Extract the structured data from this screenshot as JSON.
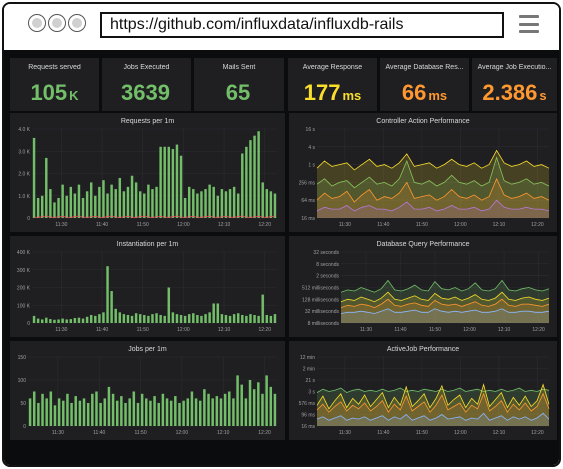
{
  "browser": {
    "url": "https://github.com/influxdata/influxdb-rails"
  },
  "stats": [
    {
      "title": "Requests served",
      "value": "105",
      "unit": "K",
      "color": "#73bf69"
    },
    {
      "title": "Jobs Executed",
      "value": "3639",
      "unit": "",
      "color": "#73bf69"
    },
    {
      "title": "Mails Sent",
      "value": "65",
      "unit": "",
      "color": "#73bf69"
    },
    {
      "title": "Average Response",
      "value": "177",
      "unit": "ms",
      "color": "#fade2a"
    },
    {
      "title": "Average Database Res...",
      "value": "66",
      "unit": "ms",
      "color": "#ff9830"
    },
    {
      "title": "Average Job Executio...",
      "value": "2.386",
      "unit": "s",
      "color": "#ff9830"
    }
  ],
  "panels": {
    "requests": {
      "title": "Requests per 1m"
    },
    "controller": {
      "title": "Controller Action Performance"
    },
    "instantiation": {
      "title": "Instantiation per 1m"
    },
    "database": {
      "title": "Database Query Performance"
    },
    "jobs": {
      "title": "Jobs per 1m"
    },
    "activejob": {
      "title": "ActiveJob Performance"
    }
  },
  "chart_data": [
    {
      "type": "bar",
      "name": "requests-per-1m",
      "title": "Requests per 1m",
      "ylim": [
        0,
        4000
      ],
      "y_ticks": [
        "0",
        "1.0 K",
        "2.0 K",
        "3.0 K",
        "4.0 K"
      ],
      "y_tick_values": [
        0,
        1000,
        2000,
        3000,
        4000
      ],
      "x_ticks": [
        "11:30",
        "11:40",
        "11:50",
        "12:00",
        "12:10",
        "12:20"
      ],
      "color": "#73bf69",
      "values": [
        3600,
        900,
        1000,
        2700,
        1300,
        700,
        900,
        1500,
        1000,
        1400,
        1100,
        1500,
        900,
        1200,
        1600,
        1000,
        1400,
        1700,
        1100,
        1500,
        1300,
        1800,
        1200,
        1400,
        1900,
        1600,
        1200,
        1100,
        1500,
        1300,
        1400,
        3200,
        3200,
        3200,
        3100,
        3300,
        2800,
        900,
        1400,
        1300,
        1100,
        1200,
        1300,
        1500,
        1400,
        1000,
        1300,
        1200,
        1300,
        1400,
        1100,
        2900,
        3200,
        3500,
        3700,
        3900,
        1600,
        1300,
        1200,
        1100
      ],
      "series2_color": "#f2495c",
      "series2_values": [
        40,
        30,
        60,
        90,
        40,
        30,
        50,
        70,
        40,
        30,
        60,
        90,
        40,
        30,
        50,
        70,
        40,
        30,
        60,
        90,
        40,
        30,
        50,
        70,
        40,
        30,
        60,
        90,
        40,
        30,
        50,
        70,
        40,
        30,
        60,
        90,
        40,
        30,
        50,
        70,
        40,
        30,
        60,
        90,
        40,
        30,
        50,
        70,
        40,
        30,
        60,
        90,
        40,
        30,
        50,
        70,
        40,
        30,
        60,
        90
      ]
    },
    {
      "type": "line",
      "name": "controller-action-performance",
      "title": "Controller Action Performance",
      "y_ticks": [
        "16 ms",
        "64 ms",
        "256 ms",
        "1 s",
        "4 s",
        "16 s"
      ],
      "x_ticks": [
        "11:30",
        "11:40",
        "11:50",
        "12:00",
        "12:10",
        "12:20"
      ],
      "series": [
        {
          "color": "#73bf69",
          "values": [
            1.9,
            2.2,
            1.8,
            2.0,
            2.1,
            1.7,
            2.0,
            2.3,
            1.9,
            2.0,
            1.8,
            2.2,
            3.2,
            2.0,
            1.9,
            2.1,
            1.8,
            2.0,
            2.4,
            2.0,
            1.9,
            2.1,
            1.8,
            2.0,
            3.4,
            2.1,
            1.9,
            2.0,
            2.2,
            1.9,
            2.0,
            1.8
          ]
        },
        {
          "color": "#fade2a",
          "values": [
            2.8,
            3.2,
            2.9,
            3.0,
            3.1,
            2.7,
            3.0,
            3.3,
            2.9,
            3.0,
            2.8,
            3.1,
            3.6,
            2.9,
            3.0,
            3.1,
            2.8,
            3.0,
            3.3,
            3.0,
            2.9,
            3.1,
            2.8,
            3.0,
            3.8,
            3.1,
            2.9,
            3.0,
            3.2,
            2.9,
            3.0,
            2.8
          ]
        },
        {
          "color": "#ff9830",
          "values": [
            1.0,
            1.4,
            1.1,
            1.2,
            1.5,
            0.9,
            1.3,
            1.6,
            1.0,
            1.2,
            1.1,
            1.4,
            2.0,
            1.1,
            1.2,
            1.3,
            1.0,
            1.2,
            1.6,
            1.2,
            1.1,
            1.3,
            1.0,
            1.2,
            2.2,
            1.3,
            1.1,
            1.2,
            1.4,
            1.1,
            1.2,
            1.0
          ]
        },
        {
          "color": "#b877d9",
          "values": [
            0.4,
            0.6,
            0.5,
            0.5,
            0.7,
            0.4,
            0.6,
            0.7,
            0.5,
            0.5,
            0.4,
            0.6,
            0.9,
            0.5,
            0.5,
            0.6,
            0.4,
            0.5,
            0.7,
            0.5,
            0.5,
            0.6,
            0.4,
            0.5,
            1.0,
            0.6,
            0.5,
            0.5,
            0.6,
            0.5,
            0.5,
            0.4
          ]
        }
      ]
    },
    {
      "type": "bar",
      "name": "instantiation-per-1m",
      "title": "Instantiation per 1m",
      "ylim": [
        0,
        400000
      ],
      "y_ticks": [
        "0",
        "100 K",
        "200 K",
        "300 K",
        "400 K"
      ],
      "y_tick_values": [
        0,
        100000,
        200000,
        300000,
        400000
      ],
      "x_ticks": [
        "11:30",
        "11:40",
        "11:50",
        "12:00",
        "12:10",
        "12:20"
      ],
      "color": "#73bf69",
      "values": [
        40000,
        25000,
        20000,
        30000,
        22000,
        18000,
        20000,
        25000,
        20000,
        22000,
        28000,
        30000,
        25000,
        35000,
        45000,
        40000,
        50000,
        60000,
        320000,
        180000,
        80000,
        60000,
        50000,
        45000,
        40000,
        55000,
        50000,
        45000,
        40000,
        50000,
        55000,
        45000,
        40000,
        200000,
        60000,
        50000,
        45000,
        40000,
        50000,
        55000,
        45000,
        40000,
        50000,
        60000,
        110000,
        110000,
        50000,
        45000,
        40000,
        50000,
        55000,
        45000,
        40000,
        50000,
        45000,
        40000,
        160000,
        45000,
        40000,
        50000
      ]
    },
    {
      "type": "line",
      "name": "database-query-performance",
      "title": "Database Query Performance",
      "y_ticks": [
        "8 milliseconds",
        "32 milliseconds",
        "128 milliseconds",
        "512 milliseconds",
        "2 seconds",
        "8 seconds",
        "32 seconds"
      ],
      "x_ticks": [
        "11:30",
        "11:40",
        "11:50",
        "12:00",
        "12:10",
        "12:20"
      ],
      "series": [
        {
          "color": "#73bf69",
          "values": [
            2.6,
            2.8,
            2.7,
            3.0,
            2.8,
            2.6,
            2.9,
            3.6,
            2.8,
            2.7,
            2.9,
            3.2,
            2.8,
            2.7,
            3.5,
            2.9,
            2.8,
            3.0,
            2.7,
            2.9,
            3.4,
            2.8,
            2.7,
            2.9,
            3.6,
            2.8,
            2.7,
            2.9,
            3.0,
            2.8,
            2.7,
            2.9
          ]
        },
        {
          "color": "#fade2a",
          "values": [
            1.8,
            2.0,
            1.9,
            2.2,
            2.0,
            1.8,
            2.1,
            2.6,
            2.0,
            1.9,
            2.1,
            2.3,
            2.0,
            1.9,
            2.5,
            2.1,
            2.0,
            2.2,
            1.9,
            2.1,
            2.4,
            2.0,
            1.9,
            2.1,
            2.6,
            2.0,
            1.9,
            2.1,
            2.2,
            2.0,
            1.9,
            2.1
          ]
        },
        {
          "color": "#ff9830",
          "values": [
            1.3,
            1.5,
            1.4,
            1.6,
            1.5,
            1.3,
            1.6,
            2.0,
            1.5,
            1.4,
            1.6,
            1.7,
            1.5,
            1.4,
            1.9,
            1.6,
            1.5,
            1.6,
            1.4,
            1.6,
            1.8,
            1.5,
            1.4,
            1.6,
            2.0,
            1.5,
            1.4,
            1.6,
            1.6,
            1.5,
            1.4,
            1.6
          ]
        },
        {
          "color": "#8ab8ff",
          "values": [
            0.8,
            0.9,
            0.9,
            1.0,
            0.9,
            0.8,
            1.0,
            1.2,
            0.9,
            0.9,
            1.0,
            1.1,
            0.9,
            0.9,
            1.2,
            1.0,
            0.9,
            1.0,
            0.9,
            1.0,
            1.1,
            0.9,
            0.9,
            1.0,
            1.2,
            0.9,
            0.9,
            1.0,
            1.0,
            0.9,
            0.9,
            1.0
          ]
        }
      ]
    },
    {
      "type": "bar",
      "name": "jobs-per-1m",
      "title": "Jobs per 1m",
      "ylim": [
        0,
        150
      ],
      "y_ticks": [
        "0",
        "50",
        "100",
        "150"
      ],
      "y_tick_values": [
        0,
        50,
        100,
        150
      ],
      "x_ticks": [
        "11:30",
        "11:40",
        "11:50",
        "12:00",
        "12:10",
        "12:20"
      ],
      "color": "#73bf69",
      "values": [
        60,
        75,
        50,
        70,
        60,
        75,
        45,
        60,
        55,
        70,
        50,
        65,
        55,
        60,
        50,
        70,
        75,
        50,
        60,
        85,
        70,
        55,
        65,
        50,
        60,
        75,
        50,
        70,
        60,
        55,
        65,
        50,
        70,
        60,
        55,
        65,
        50,
        55,
        60,
        75,
        60,
        55,
        80,
        70,
        60,
        65,
        60,
        70,
        75,
        60,
        110,
        90,
        60,
        100,
        80,
        95,
        70,
        110,
        85,
        70
      ]
    },
    {
      "type": "line",
      "name": "activejob-performance",
      "title": "ActiveJob Performance",
      "y_ticks": [
        "16 ms",
        "96 ms",
        "576 ms",
        "3 s",
        "21 s",
        "2 min",
        "12 min"
      ],
      "x_ticks": [
        "11:30",
        "11:40",
        "11:50",
        "12:00",
        "12:10",
        "12:20"
      ],
      "series": [
        {
          "color": "#73bf69",
          "values": [
            2.9,
            3.2,
            3.0,
            3.1,
            3.3,
            2.9,
            3.1,
            3.2,
            3.0,
            3.1,
            3.0,
            3.2,
            3.0,
            3.1,
            3.3,
            3.0,
            3.1,
            3.0,
            3.2,
            3.1,
            3.0,
            3.2,
            3.0,
            3.1,
            3.3,
            3.0,
            3.1,
            3.2,
            3.0,
            3.1,
            3.0,
            3.2,
            3.0,
            3.1,
            3.3,
            3.0,
            3.1,
            3.0,
            3.2,
            3.1
          ]
        },
        {
          "color": "#fade2a",
          "values": [
            1.8,
            2.6,
            1.5,
            2.2,
            2.8,
            1.6,
            2.4,
            1.9,
            2.7,
            1.7,
            2.3,
            2.9,
            1.6,
            2.5,
            1.8,
            3.4,
            1.7,
            2.2,
            2.8,
            1.6,
            2.4,
            3.5,
            1.8,
            2.3,
            2.7,
            1.6,
            2.4,
            1.9,
            3.6,
            1.7,
            2.3,
            2.9,
            1.6,
            2.5,
            1.8,
            2.6,
            1.7,
            2.2,
            3.6,
            1.9
          ]
        },
        {
          "color": "#ff9830",
          "values": [
            1.4,
            1.9,
            1.2,
            1.7,
            2.1,
            1.3,
            1.8,
            1.5,
            2.0,
            1.3,
            1.7,
            2.2,
            1.2,
            1.9,
            1.4,
            2.6,
            1.3,
            1.7,
            2.1,
            1.2,
            1.8,
            2.7,
            1.4,
            1.7,
            2.0,
            1.2,
            1.8,
            1.5,
            2.8,
            1.3,
            1.7,
            2.2,
            1.2,
            1.9,
            1.4,
            2.0,
            1.3,
            1.7,
            2.8,
            1.5
          ]
        },
        {
          "color": "#8ab8ff",
          "values": [
            0.6,
            0.8,
            0.5,
            0.7,
            0.9,
            0.5,
            0.7,
            0.6,
            0.8,
            0.5,
            0.7,
            0.9,
            0.5,
            0.8,
            0.6,
            1.0,
            0.5,
            0.7,
            0.9,
            0.5,
            0.7,
            1.0,
            0.6,
            0.7,
            0.8,
            0.5,
            0.7,
            0.6,
            1.1,
            0.5,
            0.7,
            0.9,
            0.5,
            0.8,
            0.6,
            0.8,
            0.5,
            0.7,
            1.1,
            0.6
          ]
        }
      ]
    }
  ]
}
